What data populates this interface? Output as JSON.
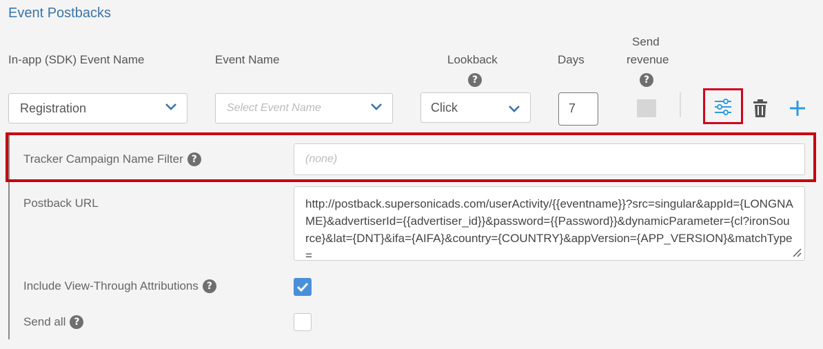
{
  "section_title": "Event Postbacks",
  "columns": {
    "sdk_event": "In-app (SDK) Event Name",
    "event_name": "Event Name",
    "lookback": "Lookback",
    "days": "Days",
    "send_revenue_line1": "Send",
    "send_revenue_line2": "revenue"
  },
  "help_glyph": "?",
  "row": {
    "sdk_event_value": "Registration",
    "event_name_placeholder": "Select Event Name",
    "lookback_value": "Click",
    "days_value": "7"
  },
  "details": {
    "tracker_filter_label": "Tracker Campaign Name Filter",
    "tracker_filter_placeholder": "(none)",
    "postback_url_label": "Postback URL",
    "postback_url_value": "http://postback.supersonicads.com/userActivity/{{eventname}}?src=singular&appId={LONGNAME}&advertiserId={{advertiser_id}}&password={{Password}}&dynamicParameter={cl?ironSource}&lat={DNT}&ifa={AIFA}&country={COUNTRY}&appVersion={APP_VERSION}&matchType=",
    "view_through_label": "Include View-Through Attributions",
    "view_through_checked": true,
    "send_all_label": "Send all",
    "send_all_checked": false
  },
  "colors": {
    "accent": "#3a74a8",
    "icon_blue": "#2b9be0",
    "highlight": "#d0021b",
    "checkbox_on": "#4a90d9"
  },
  "icons": [
    "chevron-down-icon",
    "help-icon",
    "sliders-icon",
    "trash-icon",
    "plus-icon",
    "checkmark-icon",
    "resize-handle-icon"
  ]
}
